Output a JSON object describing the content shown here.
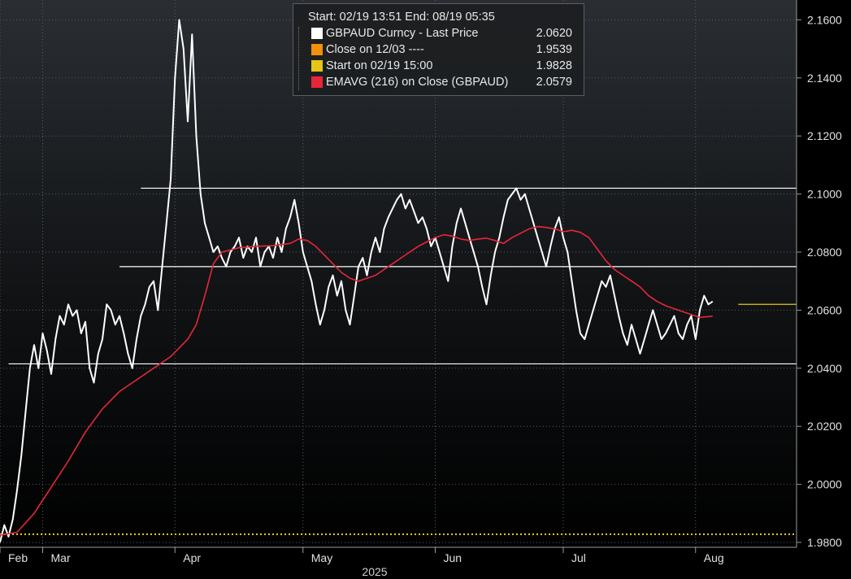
{
  "chart_data": {
    "type": "line",
    "legend_placement": "top-center",
    "legend": {
      "header": "Start: 02/19 13:51 End: 08/19 05:35",
      "items": [
        {
          "label": "GBPAUD Curncy - Last Price",
          "value": "2.0620",
          "color": "#ffffff"
        },
        {
          "label": "Close on 12/03 ----",
          "value": "1.9539",
          "color": "#f0900c"
        },
        {
          "label": "Start on 02/19 15:00",
          "value": "1.9828",
          "color": "#e6c617"
        },
        {
          "label": "EMAVG (216)  on Close (GBPAUD)",
          "value": "2.0579",
          "color": "#e8263a"
        }
      ]
    },
    "y_ticks": [
      "2.1600",
      "2.1400",
      "2.1200",
      "2.1000",
      "2.0800",
      "2.0600",
      "2.0400",
      "2.0200",
      "2.0000",
      "1.9800"
    ],
    "ylim": [
      1.975,
      2.165
    ],
    "x_months": [
      {
        "label": "Feb",
        "day": 0
      },
      {
        "label": "Mar",
        "day": 10
      },
      {
        "label": "Apr",
        "day": 41
      },
      {
        "label": "May",
        "day": 71
      },
      {
        "label": "Jun",
        "day": 102
      },
      {
        "label": "Jul",
        "day": 132
      },
      {
        "label": "Aug",
        "day": 163
      }
    ],
    "x_year": "2025",
    "xlim_days": [
      0,
      190
    ],
    "grid": true,
    "horizontal_lines": [
      {
        "value": 2.102,
        "from_day": 33,
        "color": "#ffffff"
      },
      {
        "value": 2.075,
        "from_day": 28,
        "color": "#ffffff"
      },
      {
        "value": 2.0415,
        "from_day": 2,
        "color": "#ffffff"
      },
      {
        "value": 1.9828,
        "from_day": 0,
        "color": "#e6c617",
        "dotted": true
      },
      {
        "value": 2.062,
        "from_day": 173,
        "color": "#e6c617"
      }
    ],
    "series": [
      {
        "name": "GBPAUD Curncy - Last Price",
        "color": "#ffffff",
        "points": [
          [
            0,
            1.98
          ],
          [
            1,
            1.986
          ],
          [
            2,
            1.982
          ],
          [
            3,
            1.988
          ],
          [
            4,
            1.998
          ],
          [
            5,
            2.01
          ],
          [
            6,
            2.025
          ],
          [
            7,
            2.04
          ],
          [
            8,
            2.048
          ],
          [
            9,
            2.04
          ],
          [
            10,
            2.052
          ],
          [
            11,
            2.046
          ],
          [
            12,
            2.038
          ],
          [
            13,
            2.05
          ],
          [
            14,
            2.058
          ],
          [
            15,
            2.055
          ],
          [
            16,
            2.062
          ],
          [
            17,
            2.058
          ],
          [
            18,
            2.06
          ],
          [
            19,
            2.052
          ],
          [
            20,
            2.056
          ],
          [
            21,
            2.04
          ],
          [
            22,
            2.035
          ],
          [
            23,
            2.045
          ],
          [
            24,
            2.05
          ],
          [
            25,
            2.062
          ],
          [
            26,
            2.06
          ],
          [
            27,
            2.055
          ],
          [
            28,
            2.058
          ],
          [
            29,
            2.052
          ],
          [
            30,
            2.045
          ],
          [
            31,
            2.04
          ],
          [
            32,
            2.05
          ],
          [
            33,
            2.058
          ],
          [
            34,
            2.062
          ],
          [
            35,
            2.068
          ],
          [
            36,
            2.07
          ],
          [
            37,
            2.06
          ],
          [
            38,
            2.075
          ],
          [
            39,
            2.09
          ],
          [
            40,
            2.105
          ],
          [
            41,
            2.14
          ],
          [
            42,
            2.16
          ],
          [
            43,
            2.15
          ],
          [
            44,
            2.125
          ],
          [
            45,
            2.155
          ],
          [
            46,
            2.12
          ],
          [
            47,
            2.1
          ],
          [
            48,
            2.09
          ],
          [
            49,
            2.085
          ],
          [
            50,
            2.08
          ],
          [
            51,
            2.082
          ],
          [
            52,
            2.078
          ],
          [
            53,
            2.075
          ],
          [
            54,
            2.08
          ],
          [
            55,
            2.082
          ],
          [
            56,
            2.085
          ],
          [
            57,
            2.078
          ],
          [
            58,
            2.082
          ],
          [
            59,
            2.08
          ],
          [
            60,
            2.085
          ],
          [
            61,
            2.075
          ],
          [
            62,
            2.08
          ],
          [
            63,
            2.082
          ],
          [
            64,
            2.078
          ],
          [
            65,
            2.085
          ],
          [
            66,
            2.08
          ],
          [
            67,
            2.088
          ],
          [
            68,
            2.092
          ],
          [
            69,
            2.098
          ],
          [
            70,
            2.09
          ],
          [
            71,
            2.08
          ],
          [
            72,
            2.075
          ],
          [
            73,
            2.07
          ],
          [
            74,
            2.062
          ],
          [
            75,
            2.055
          ],
          [
            76,
            2.06
          ],
          [
            77,
            2.068
          ],
          [
            78,
            2.072
          ],
          [
            79,
            2.065
          ],
          [
            80,
            2.07
          ],
          [
            81,
            2.06
          ],
          [
            82,
            2.055
          ],
          [
            83,
            2.065
          ],
          [
            84,
            2.075
          ],
          [
            85,
            2.078
          ],
          [
            86,
            2.072
          ],
          [
            87,
            2.08
          ],
          [
            88,
            2.085
          ],
          [
            89,
            2.08
          ],
          [
            90,
            2.088
          ],
          [
            91,
            2.092
          ],
          [
            92,
            2.095
          ],
          [
            93,
            2.098
          ],
          [
            94,
            2.1
          ],
          [
            95,
            2.095
          ],
          [
            96,
            2.098
          ],
          [
            97,
            2.094
          ],
          [
            98,
            2.09
          ],
          [
            99,
            2.092
          ],
          [
            100,
            2.088
          ],
          [
            101,
            2.082
          ],
          [
            102,
            2.085
          ],
          [
            103,
            2.08
          ],
          [
            104,
            2.075
          ],
          [
            105,
            2.07
          ],
          [
            106,
            2.082
          ],
          [
            107,
            2.09
          ],
          [
            108,
            2.095
          ],
          [
            109,
            2.09
          ],
          [
            110,
            2.085
          ],
          [
            111,
            2.08
          ],
          [
            112,
            2.075
          ],
          [
            113,
            2.068
          ],
          [
            114,
            2.062
          ],
          [
            115,
            2.072
          ],
          [
            116,
            2.08
          ],
          [
            117,
            2.085
          ],
          [
            118,
            2.092
          ],
          [
            119,
            2.098
          ],
          [
            120,
            2.1
          ],
          [
            121,
            2.102
          ],
          [
            122,
            2.098
          ],
          [
            123,
            2.1
          ],
          [
            124,
            2.095
          ],
          [
            125,
            2.09
          ],
          [
            126,
            2.085
          ],
          [
            127,
            2.08
          ],
          [
            128,
            2.075
          ],
          [
            129,
            2.082
          ],
          [
            130,
            2.088
          ],
          [
            131,
            2.092
          ],
          [
            132,
            2.085
          ],
          [
            133,
            2.08
          ],
          [
            134,
            2.07
          ],
          [
            135,
            2.06
          ],
          [
            136,
            2.052
          ],
          [
            137,
            2.05
          ],
          [
            138,
            2.055
          ],
          [
            139,
            2.06
          ],
          [
            140,
            2.065
          ],
          [
            141,
            2.07
          ],
          [
            142,
            2.068
          ],
          [
            143,
            2.072
          ],
          [
            144,
            2.065
          ],
          [
            145,
            2.058
          ],
          [
            146,
            2.052
          ],
          [
            147,
            2.048
          ],
          [
            148,
            2.055
          ],
          [
            149,
            2.05
          ],
          [
            150,
            2.045
          ],
          [
            151,
            2.05
          ],
          [
            152,
            2.055
          ],
          [
            153,
            2.06
          ],
          [
            154,
            2.055
          ],
          [
            155,
            2.05
          ],
          [
            156,
            2.052
          ],
          [
            157,
            2.055
          ],
          [
            158,
            2.058
          ],
          [
            159,
            2.052
          ],
          [
            160,
            2.05
          ],
          [
            161,
            2.055
          ],
          [
            162,
            2.058
          ],
          [
            163,
            2.05
          ],
          [
            164,
            2.06
          ],
          [
            165,
            2.065
          ],
          [
            166,
            2.062
          ],
          [
            167,
            2.063
          ]
        ]
      },
      {
        "name": "EMAVG (216)  on Close (GBPAUD)",
        "color": "#e8263a",
        "points": [
          [
            0,
            1.9825
          ],
          [
            4,
            1.9835
          ],
          [
            8,
            1.99
          ],
          [
            12,
            1.999
          ],
          [
            16,
            2.008
          ],
          [
            20,
            2.018
          ],
          [
            24,
            2.026
          ],
          [
            28,
            2.032
          ],
          [
            32,
            2.036
          ],
          [
            36,
            2.04
          ],
          [
            40,
            2.044
          ],
          [
            44,
            2.05
          ],
          [
            46,
            2.055
          ],
          [
            48,
            2.065
          ],
          [
            50,
            2.076
          ],
          [
            52,
            2.08
          ],
          [
            56,
            2.0815
          ],
          [
            60,
            2.082
          ],
          [
            64,
            2.0822
          ],
          [
            68,
            2.083
          ],
          [
            70,
            2.0845
          ],
          [
            72,
            2.084
          ],
          [
            74,
            2.082
          ],
          [
            76,
            2.079
          ],
          [
            78,
            2.076
          ],
          [
            80,
            2.073
          ],
          [
            82,
            2.071
          ],
          [
            84,
            2.07
          ],
          [
            86,
            2.071
          ],
          [
            88,
            2.072
          ],
          [
            90,
            2.074
          ],
          [
            92,
            2.076
          ],
          [
            94,
            2.078
          ],
          [
            96,
            2.08
          ],
          [
            98,
            2.082
          ],
          [
            100,
            2.0835
          ],
          [
            102,
            2.085
          ],
          [
            104,
            2.086
          ],
          [
            106,
            2.0855
          ],
          [
            108,
            2.0845
          ],
          [
            110,
            2.084
          ],
          [
            112,
            2.0845
          ],
          [
            114,
            2.0848
          ],
          [
            116,
            2.084
          ],
          [
            118,
            2.083
          ],
          [
            120,
            2.085
          ],
          [
            122,
            2.0865
          ],
          [
            124,
            2.088
          ],
          [
            126,
            2.0888
          ],
          [
            128,
            2.0885
          ],
          [
            130,
            2.088
          ],
          [
            132,
            2.087
          ],
          [
            134,
            2.0875
          ],
          [
            136,
            2.0868
          ],
          [
            138,
            2.085
          ],
          [
            140,
            2.081
          ],
          [
            142,
            2.077
          ],
          [
            144,
            2.074
          ],
          [
            146,
            2.072
          ],
          [
            148,
            2.07
          ],
          [
            150,
            2.068
          ],
          [
            152,
            2.065
          ],
          [
            154,
            2.063
          ],
          [
            156,
            2.0615
          ],
          [
            158,
            2.0605
          ],
          [
            160,
            2.0595
          ],
          [
            162,
            2.0585
          ],
          [
            164,
            2.0575
          ],
          [
            166,
            2.0578
          ],
          [
            167,
            2.0579
          ]
        ]
      }
    ]
  }
}
